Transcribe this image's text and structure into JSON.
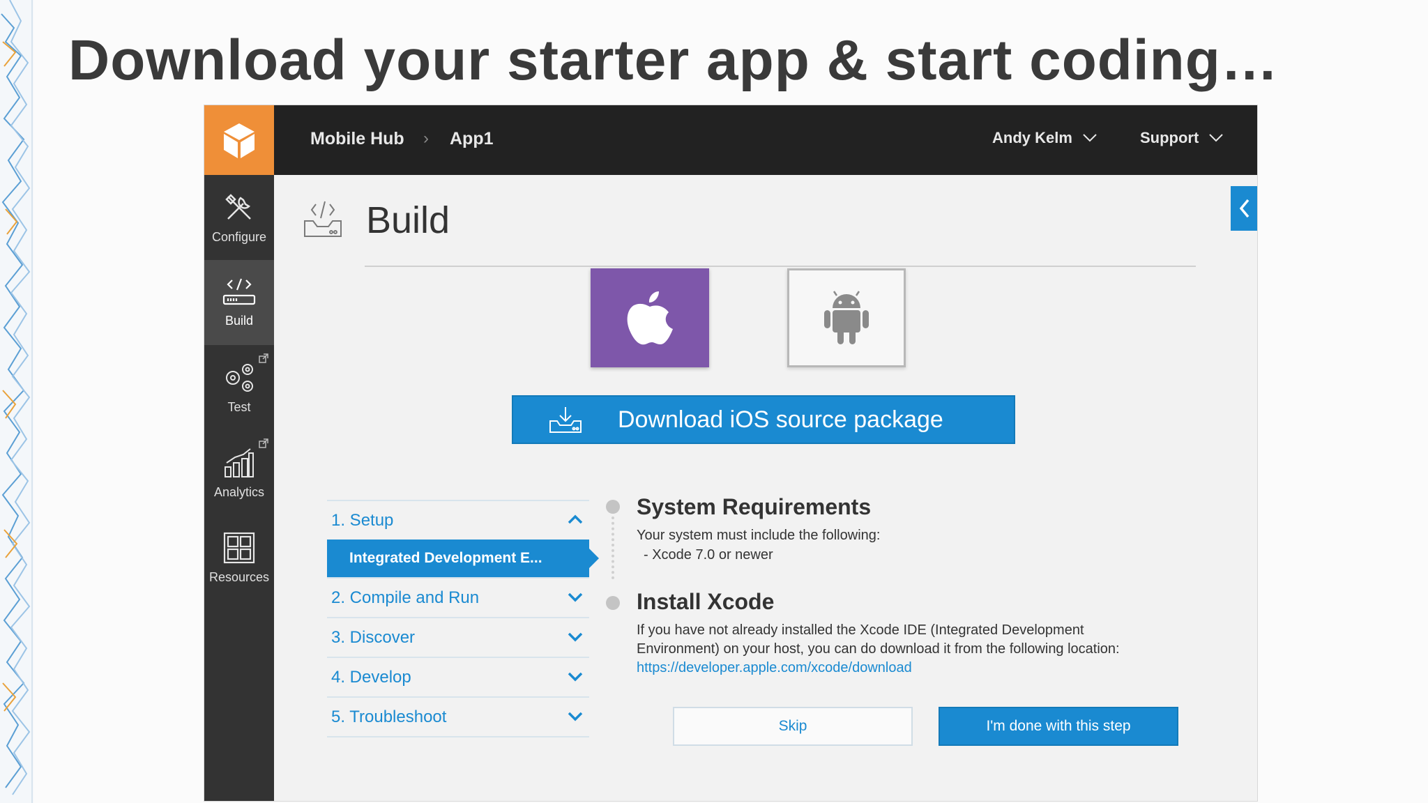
{
  "slide": {
    "title": "Download your starter app & start coding…"
  },
  "topbar": {
    "breadcrumb": [
      "Mobile Hub",
      "App1"
    ],
    "user_menu": "Andy Kelm",
    "support_menu": "Support"
  },
  "sidebar": {
    "items": [
      {
        "label": "Configure",
        "icon": "tools-icon",
        "active": false
      },
      {
        "label": "Build",
        "icon": "code-build-icon",
        "active": true
      },
      {
        "label": "Test",
        "icon": "gears-icon",
        "active": false
      },
      {
        "label": "Analytics",
        "icon": "chart-icon",
        "active": false
      },
      {
        "label": "Resources",
        "icon": "grid-icon",
        "active": false
      }
    ]
  },
  "build": {
    "title": "Build",
    "platforms": [
      "apple-icon",
      "android-icon"
    ],
    "download_label": "Download iOS source package"
  },
  "steps": [
    {
      "label": "1. Setup",
      "expanded": true
    },
    {
      "label": "Integrated Development E...",
      "sub": true
    },
    {
      "label": "2. Compile and Run"
    },
    {
      "label": "3. Discover"
    },
    {
      "label": "4. Develop"
    },
    {
      "label": "5. Troubleshoot"
    }
  ],
  "details": {
    "sys_req_title": "System Requirements",
    "sys_req_text": "Your system must include the following:",
    "sys_req_item": "- Xcode 7.0 or newer",
    "install_title": "Install Xcode",
    "install_text_1": "If you have not already installed the Xcode IDE (Integrated Development",
    "install_text_2": "Environment) on your host, you can do download it from the following location:",
    "install_link": "https://developer.apple.com/xcode/download"
  },
  "actions": {
    "skip": "Skip",
    "done": "I'm done with this step"
  },
  "colors": {
    "accent": "#1a8ad1",
    "logo_orange": "#ef8f38",
    "ios_purple": "#7e57aa",
    "topbar": "#222222",
    "sidebar": "#333333"
  }
}
